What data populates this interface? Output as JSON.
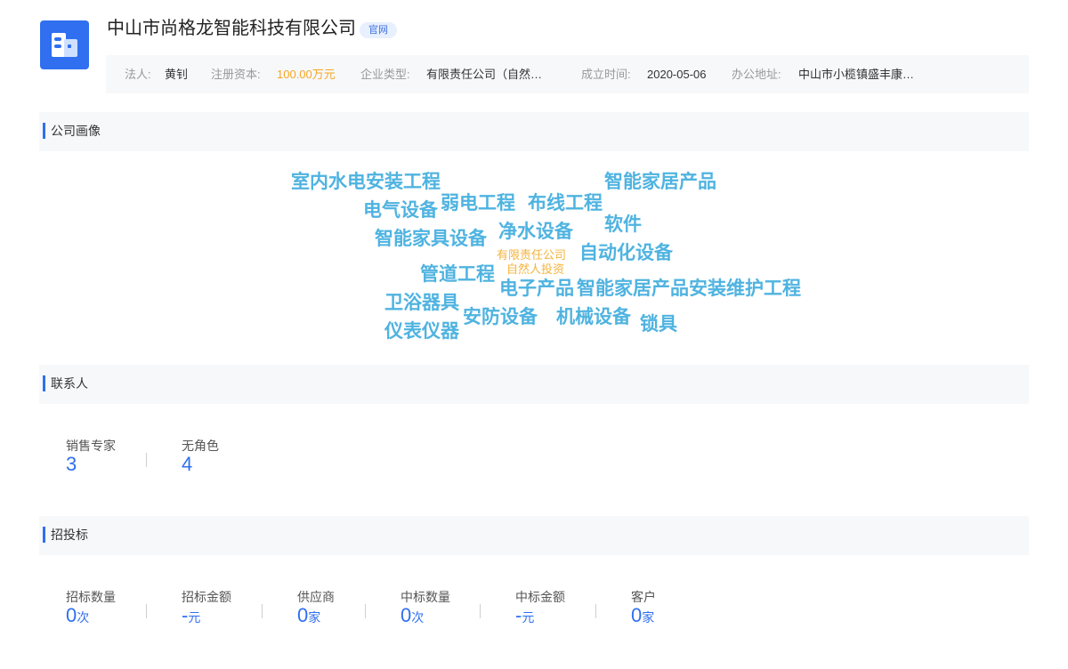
{
  "header": {
    "logo_icon": "building-icon",
    "company_name": "中山市尚格龙智能科技有限公司",
    "site_tag": "官网",
    "info": {
      "legal_label": "法人:",
      "legal_value": "黄钊",
      "capital_label": "注册资本:",
      "capital_value": "100.00万元",
      "type_label": "企业类型:",
      "type_value": "有限责任公司（自然…",
      "founded_label": "成立时间:",
      "founded_value": "2020-05-06",
      "address_label": "办公地址:",
      "address_value": "中山市小榄镇盛丰康…"
    }
  },
  "portrait": {
    "title": "公司画像",
    "words": [
      "室内水电安装工程",
      "智能家居产品",
      "电气设备",
      "弱电工程",
      "布线工程",
      "智能家具设备",
      "净水设备",
      "软件",
      "有限责任公司",
      "自然人投资",
      "自动化设备",
      "管道工程",
      "电子产品",
      "智能家居产品安装维护工程",
      "卫浴器具",
      "安防设备",
      "机械设备",
      "锁具",
      "仪表仪器"
    ]
  },
  "contacts": {
    "title": "联系人",
    "stats": [
      {
        "label": "销售专家",
        "value": "3"
      },
      {
        "label": "无角色",
        "value": "4"
      }
    ]
  },
  "bidding": {
    "title": "招投标",
    "stats": [
      {
        "label": "招标数量",
        "value": "0",
        "unit": "次"
      },
      {
        "label": "招标金额",
        "value": "-",
        "unit": "元"
      },
      {
        "label": "供应商",
        "value": "0",
        "unit": "家"
      },
      {
        "label": "中标数量",
        "value": "0",
        "unit": "次"
      },
      {
        "label": "中标金额",
        "value": "-",
        "unit": "元"
      },
      {
        "label": "客户",
        "value": "0",
        "unit": "家"
      }
    ]
  },
  "colors": {
    "accent": "#2f6ff0",
    "money": "#f5a623",
    "cloud_primary": "#4fb3e0",
    "cloud_secondary": "#f5b33c"
  }
}
